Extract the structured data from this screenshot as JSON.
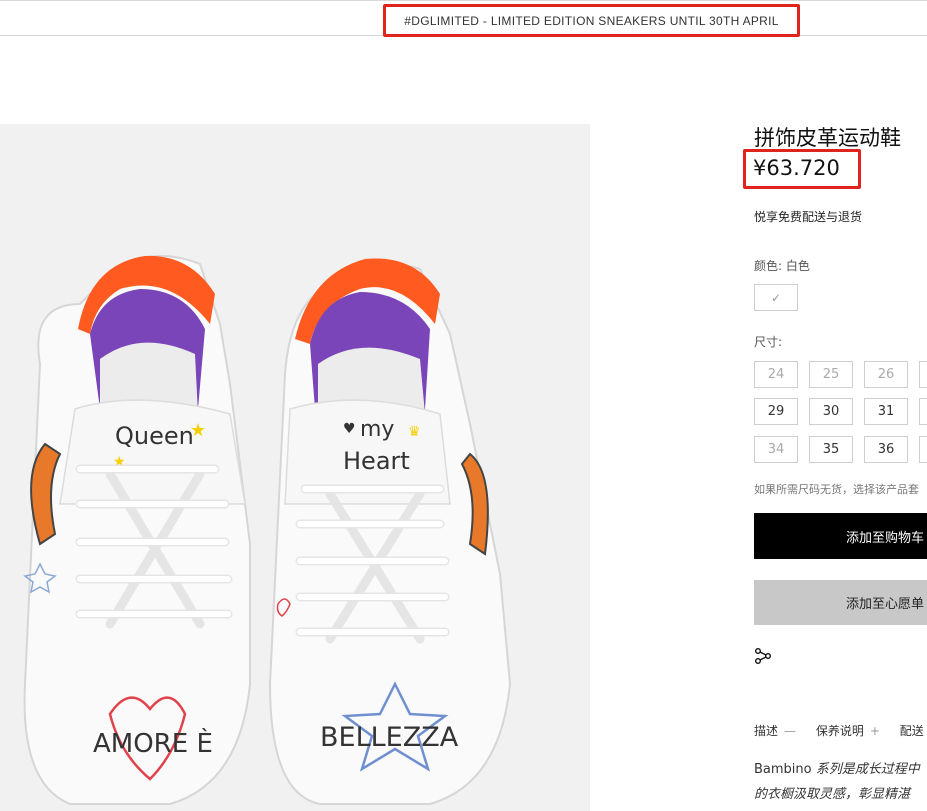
{
  "promo_banner": "#DGLIMITED - LIMITED EDITION SNEAKERS UNTIL 30TH APRIL",
  "product": {
    "title": "拼饰皮革运动鞋",
    "price": "¥63.720",
    "shipping": "悦享免费配送与退货",
    "color_label": "颜色: 白色",
    "size_label": "尺寸:",
    "sizes": [
      "24",
      "25",
      "26",
      "29",
      "30",
      "31",
      "34",
      "35",
      "36"
    ],
    "size_note": "如果所需尺码无货，选择该产品套",
    "add_to_cart": "添加至购物车",
    "add_to_wishlist": "添加至心愿单"
  },
  "tabs": [
    {
      "label": "描述",
      "symbol": "—"
    },
    {
      "label": "保养说明",
      "symbol": "+"
    },
    {
      "label": "配送",
      "symbol": ""
    }
  ],
  "description": {
    "line1_prefix": "Bambino",
    "line1_rest": " 系列是成长过程中",
    "line2": "的衣橱汲取灵感，彰显精湛"
  },
  "shoe_text": {
    "left_tongue_1": "Queen",
    "left_toe": "AMORE È",
    "right_tongue_1": "my",
    "right_tongue_2": "Heart",
    "right_toe": "BELLEZZA"
  },
  "icons": {
    "swatch_check": "check-icon",
    "share": "share-icon"
  },
  "colors": {
    "highlight": "#e0241c",
    "cart_button": "#000000",
    "wishlist_button": "#c8c8c8"
  }
}
